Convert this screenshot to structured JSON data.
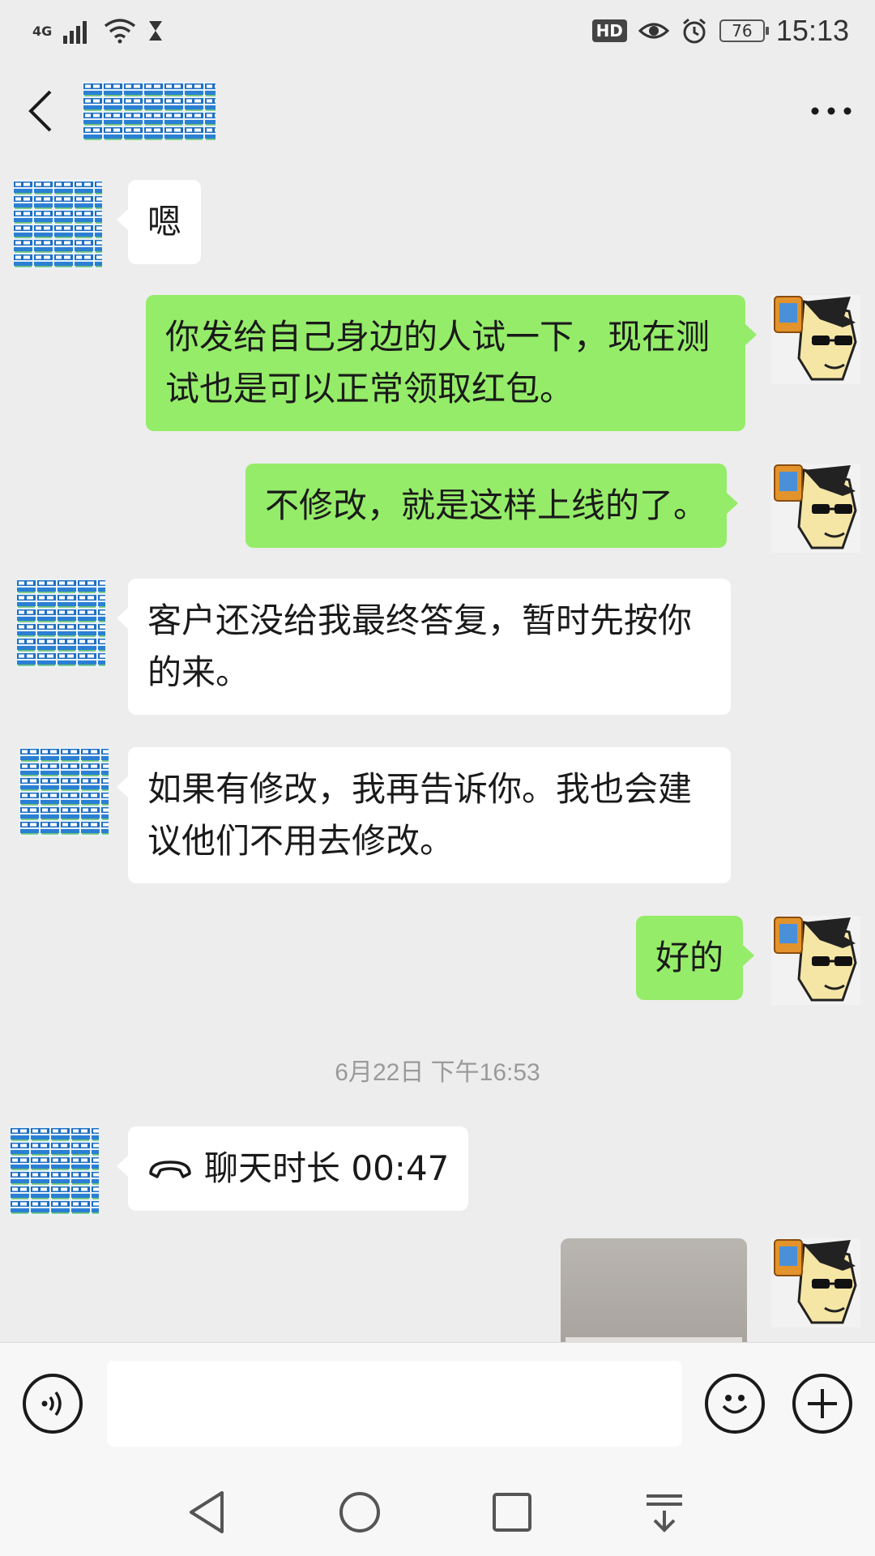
{
  "status_bar": {
    "network_label": "4G",
    "hd_label": "HD",
    "battery": "76",
    "time": "15:13"
  },
  "chat": {
    "messages": [
      {
        "side": "in",
        "text": "嗯"
      },
      {
        "side": "out",
        "text": "你发给自己身边的人试一下，现在测试也是可以正常领取红包。"
      },
      {
        "side": "out",
        "text": "不修改，就是这样上线的了。"
      },
      {
        "side": "in",
        "text": "客户还没给我最终答复，暂时先按你的来。"
      },
      {
        "side": "in",
        "text": "如果有修改，我再告诉你。我也会建议他们不用去修改。"
      },
      {
        "side": "out",
        "text": "好的"
      }
    ],
    "timestamp": "6月22日 下午16:53",
    "call_message": {
      "side": "in",
      "text": "聊天时长 00:47",
      "icon": "phone-hangup-icon"
    },
    "image_message": {
      "side": "out",
      "icon": "image-thumbnail"
    }
  },
  "icons": {
    "back": "back-arrow-icon",
    "more": "more-icon",
    "voice": "voice-icon",
    "emoji": "emoji-icon",
    "plus": "plus-icon"
  },
  "colors": {
    "background": "#ededed",
    "outgoing_bubble": "#95ec69",
    "incoming_bubble": "#ffffff",
    "timestamp": "#9a9a9a"
  }
}
